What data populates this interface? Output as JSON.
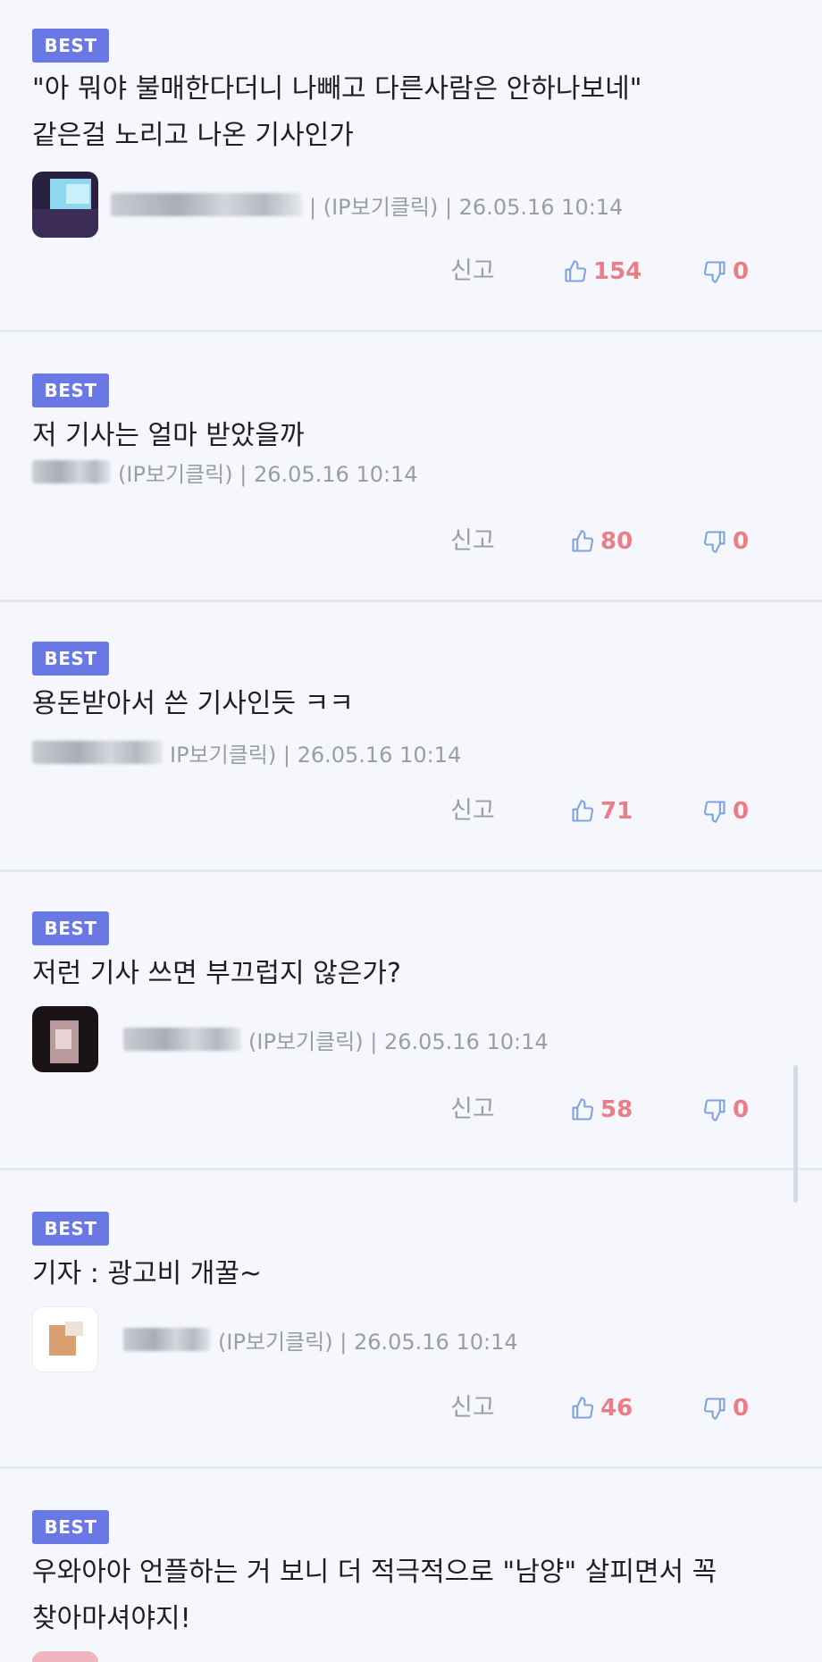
{
  "badge_label": "BEST",
  "report_label": "신고",
  "comments": [
    {
      "text": "\"아 뭐야 불매한다더니 나빼고 다른사람은 안하나보네\"\n같은걸 노리고 나온 기사인가",
      "meta": "| (IP보기클릭) | 26.05.16 10:14",
      "likes": "154",
      "dislikes": "0"
    },
    {
      "text": "저 기사는 얼마 받았을까",
      "meta": "(IP보기클릭) | 26.05.16 10:14",
      "likes": "80",
      "dislikes": "0"
    },
    {
      "text": "용돈받아서 쓴 기사인듯 ㅋㅋ",
      "meta": "IP보기클릭) | 26.05.16 10:14",
      "likes": "71",
      "dislikes": "0"
    },
    {
      "text": "저런 기사 쓰면 부끄럽지 않은가?",
      "meta": "(IP보기클릭) | 26.05.16 10:14",
      "likes": "58",
      "dislikes": "0"
    },
    {
      "text": "기자 : 광고비 개꿀~",
      "meta": "(IP보기클릭) | 26.05.16 10:14",
      "likes": "46",
      "dislikes": "0"
    },
    {
      "text": "우와아아 언플하는 거 보니 더 적극적으로 \"남양\" 살피면서 꼭\n찾아마셔야지!"
    }
  ],
  "icons": {
    "like": "thumbs-up-icon",
    "dislike": "thumbs-down-icon"
  },
  "colors": {
    "badge": "#6a78e6",
    "count": "#ea7e86",
    "icon": "#7ea3dd",
    "meta": "#9a9da6",
    "background": "#f5f7fc"
  }
}
